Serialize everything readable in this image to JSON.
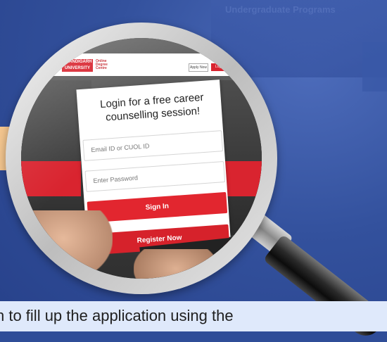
{
  "background": {
    "heading": "Undergraduate Programs",
    "colors": {
      "blue": "#2f4d98",
      "accent_orange": "#f3c58e",
      "caption_bg": "#dfe9fb",
      "brand_red": "#d9242f"
    }
  },
  "lens": {
    "site": {
      "logo_text": "CHANDIGARH UNIVERSITY",
      "logo_sub": "Online Degree Centre",
      "top_buttons": [
        "Apply Now",
        "Login"
      ]
    },
    "login_card": {
      "title": "Login for a free career counselling session!",
      "email_placeholder": "Email ID or CUOL ID",
      "password_placeholder": "Enter Password",
      "sign_in_label": "Sign In",
      "register_label": "Register Now"
    }
  },
  "caption": {
    "text": "n to fill up the application using the"
  }
}
